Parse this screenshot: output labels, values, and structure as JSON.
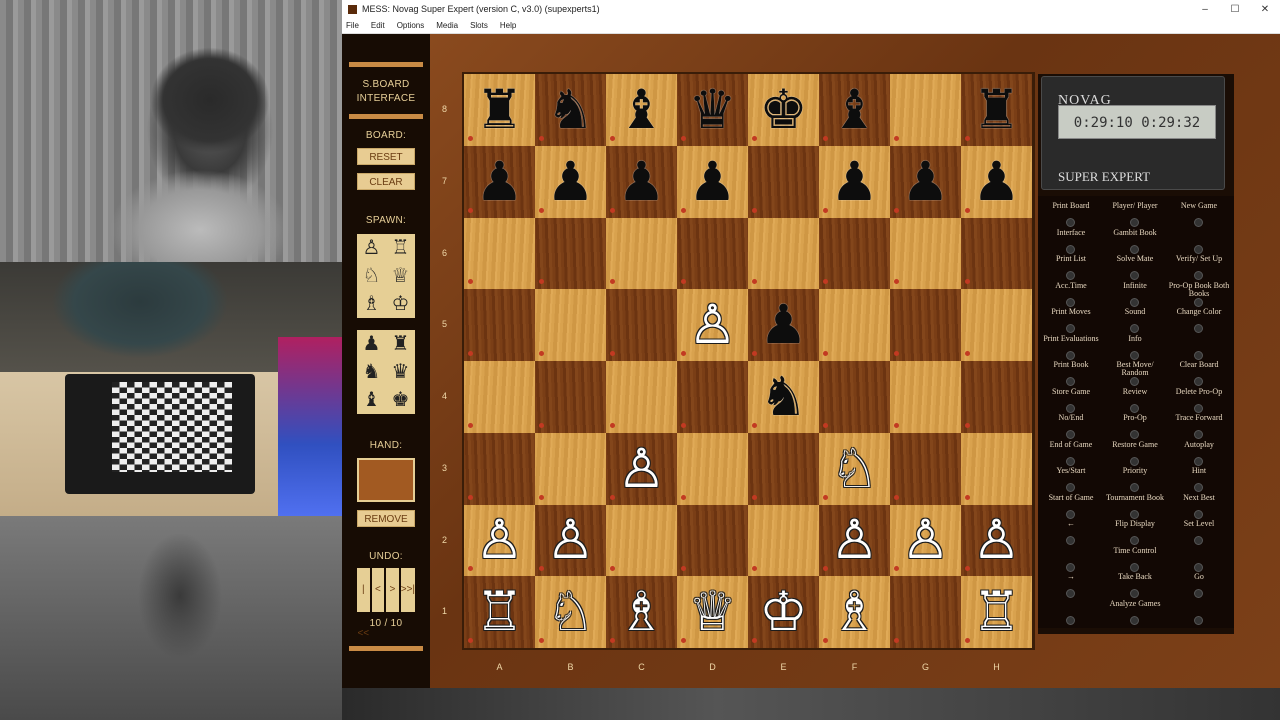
{
  "window": {
    "title": "MESS: Novag Super Expert (version C, v3.0) (supexperts1)",
    "controls": [
      "–",
      "☐",
      "✕"
    ]
  },
  "menu": [
    "File",
    "Edit",
    "Options",
    "Media",
    "Slots",
    "Help"
  ],
  "panel": {
    "header": "S.BOARD INTERFACE",
    "board_label": "BOARD:",
    "reset": "RESET",
    "clear": "CLEAR",
    "spawn_label": "SPAWN:",
    "spawn_white": [
      "♙",
      "♖",
      "♘",
      "♕",
      "♗",
      "♔"
    ],
    "spawn_black": [
      "♟",
      "♜",
      "♞",
      "♛",
      "♝",
      "♚"
    ],
    "hand_label": "HAND:",
    "remove": "REMOVE",
    "undo_label": "UNDO:",
    "undo_buttons": [
      "|<<",
      "<",
      ">",
      ">>|"
    ],
    "undo_count": "10 / 10"
  },
  "board": {
    "ranks": [
      "8",
      "7",
      "6",
      "5",
      "4",
      "3",
      "2",
      "1"
    ],
    "files": [
      "A",
      "B",
      "C",
      "D",
      "E",
      "F",
      "G",
      "H"
    ],
    "position": [
      [
        "br",
        "bn",
        "bb",
        "bq",
        "bk",
        "bb",
        "",
        "br"
      ],
      [
        "bp",
        "bp",
        "bp",
        "bp",
        "",
        "bp",
        "bp",
        "bp"
      ],
      [
        "",
        "",
        "",
        "",
        "",
        "",
        "",
        ""
      ],
      [
        "",
        "",
        "",
        "wp",
        "bp",
        "",
        "",
        ""
      ],
      [
        "",
        "",
        "",
        "",
        "bn",
        "",
        "",
        ""
      ],
      [
        "",
        "",
        "wp",
        "",
        "",
        "wn",
        "",
        ""
      ],
      [
        "wp",
        "wp",
        "",
        "",
        "",
        "wp",
        "wp",
        "wp"
      ],
      [
        "wr",
        "wn",
        "wb",
        "wq",
        "wk",
        "wb",
        "",
        "wr"
      ]
    ]
  },
  "novag": {
    "brand": "NOVAG",
    "clock": "0:29:10 0:29:32",
    "model": "SUPER EXPERT",
    "keys": [
      {
        "t": "Print Board",
        "c": 0,
        "r": 0
      },
      {
        "t": "Player/ Player",
        "c": 1,
        "r": 0
      },
      {
        "t": "New Game",
        "c": 2,
        "r": 0
      },
      {
        "t": "Interface",
        "c": 0,
        "r": 1
      },
      {
        "t": "Gambit Book",
        "c": 1,
        "r": 1
      },
      {
        "t": "",
        "c": 2,
        "r": 1
      },
      {
        "t": "Print List",
        "c": 0,
        "r": 2
      },
      {
        "t": "Solve Mate",
        "c": 1,
        "r": 2
      },
      {
        "t": "Verify/ Set Up",
        "c": 2,
        "r": 2
      },
      {
        "t": "Acc.Time",
        "c": 0,
        "r": 3
      },
      {
        "t": "Infinite",
        "c": 1,
        "r": 3
      },
      {
        "t": "Pro-Op Book Both Books",
        "c": 2,
        "r": 3
      },
      {
        "t": "Print Moves",
        "c": 0,
        "r": 4
      },
      {
        "t": "Sound",
        "c": 1,
        "r": 4
      },
      {
        "t": "Change Color",
        "c": 2,
        "r": 4
      },
      {
        "t": "Print Evaluations",
        "c": 0,
        "r": 5
      },
      {
        "t": "Info",
        "c": 1,
        "r": 5
      },
      {
        "t": "",
        "c": 2,
        "r": 5
      },
      {
        "t": "Print Book",
        "c": 0,
        "r": 6
      },
      {
        "t": "Best Move/ Random",
        "c": 1,
        "r": 6
      },
      {
        "t": "Clear Board",
        "c": 2,
        "r": 6
      },
      {
        "t": "Store Game",
        "c": 0,
        "r": 7
      },
      {
        "t": "Review",
        "c": 1,
        "r": 7
      },
      {
        "t": "Delete Pro-Op",
        "c": 2,
        "r": 7
      },
      {
        "t": "No/End",
        "c": 0,
        "r": 8
      },
      {
        "t": "Pro-Op",
        "c": 1,
        "r": 8
      },
      {
        "t": "Trace Forward",
        "c": 2,
        "r": 8
      },
      {
        "t": "End of Game",
        "c": 0,
        "r": 9
      },
      {
        "t": "Restore Game",
        "c": 1,
        "r": 9
      },
      {
        "t": "Autoplay",
        "c": 2,
        "r": 9
      },
      {
        "t": "Yes/Start",
        "c": 0,
        "r": 10
      },
      {
        "t": "Priority",
        "c": 1,
        "r": 10
      },
      {
        "t": "Hint",
        "c": 2,
        "r": 10
      },
      {
        "t": "Start of Game",
        "c": 0,
        "r": 11
      },
      {
        "t": "Tournament Book",
        "c": 1,
        "r": 11
      },
      {
        "t": "Next Best",
        "c": 2,
        "r": 11
      },
      {
        "t": "←",
        "c": 0,
        "r": 12
      },
      {
        "t": "Flip Display",
        "c": 1,
        "r": 12
      },
      {
        "t": "Set Level",
        "c": 2,
        "r": 12
      },
      {
        "t": "",
        "c": 0,
        "r": 13
      },
      {
        "t": "Time Control",
        "c": 1,
        "r": 13
      },
      {
        "t": "",
        "c": 2,
        "r": 13
      },
      {
        "t": "→",
        "c": 0,
        "r": 14
      },
      {
        "t": "Take Back",
        "c": 1,
        "r": 14
      },
      {
        "t": "Go",
        "c": 2,
        "r": 14
      },
      {
        "t": "",
        "c": 0,
        "r": 15
      },
      {
        "t": "Analyze Games",
        "c": 1,
        "r": 15
      },
      {
        "t": "",
        "c": 2,
        "r": 15
      }
    ]
  }
}
